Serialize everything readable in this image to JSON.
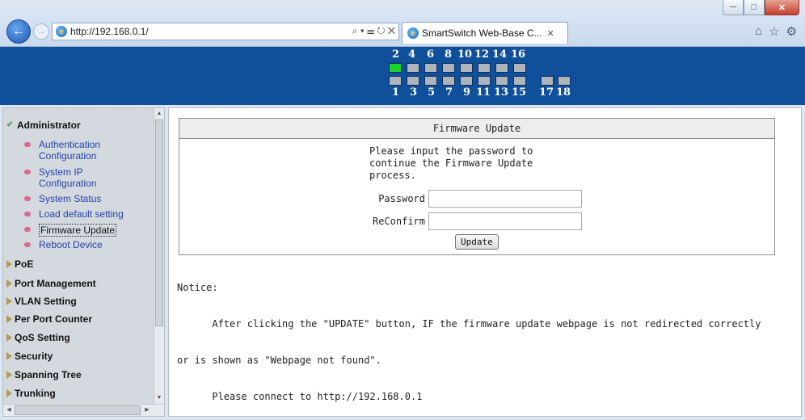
{
  "browser": {
    "url": "http://192.168.0.1/",
    "tab_title": "SmartSwitch Web-Base C...",
    "address_tools": "⌕ ▾ ☰ ↻ ✕"
  },
  "banner": {
    "top_port_numbers": [
      "2",
      "4",
      "6",
      "8",
      "10",
      "12",
      "14",
      "16"
    ],
    "bottom_port_numbers": [
      "1",
      "3",
      "5",
      "7",
      "9",
      "11",
      "13",
      "15"
    ],
    "uplink_port_numbers": [
      "17",
      "18"
    ],
    "active_ports": [
      "2"
    ],
    "colors": {
      "banner": "#0d4f9c",
      "active_port": "#1bd32a",
      "inactive_port": "#aeb4bb"
    }
  },
  "sidebar": {
    "sections": [
      {
        "label": "Administrator",
        "expanded": true
      },
      {
        "label": "PoE"
      },
      {
        "label": "Port Management"
      },
      {
        "label": "VLAN Setting"
      },
      {
        "label": "Per Port Counter"
      },
      {
        "label": "QoS Setting"
      },
      {
        "label": "Security"
      },
      {
        "label": "Spanning Tree"
      },
      {
        "label": "Trunking"
      }
    ],
    "admin_items": [
      "Authentication Configuration",
      "System IP Configuration",
      "System Status",
      "Load default setting",
      "Firmware Update",
      "Reboot Device"
    ],
    "current_item": "Firmware Update"
  },
  "firmware": {
    "title": "Firmware Update",
    "message_lines": [
      "Please input the password to",
      "continue the Firmware Update",
      "process."
    ],
    "password_label": "Password",
    "password_value": "",
    "reconfirm_label": "ReConfirm",
    "reconfirm_value": "",
    "update_button": "Update"
  },
  "notice": {
    "heading": "Notice:",
    "line1": "      After clicking the \"UPDATE\" button, IF the firmware update webpage is not redirected correctly",
    "line2": "or is shown as \"Webpage not found\".",
    "line3": "      Please connect to http://192.168.0.1"
  }
}
